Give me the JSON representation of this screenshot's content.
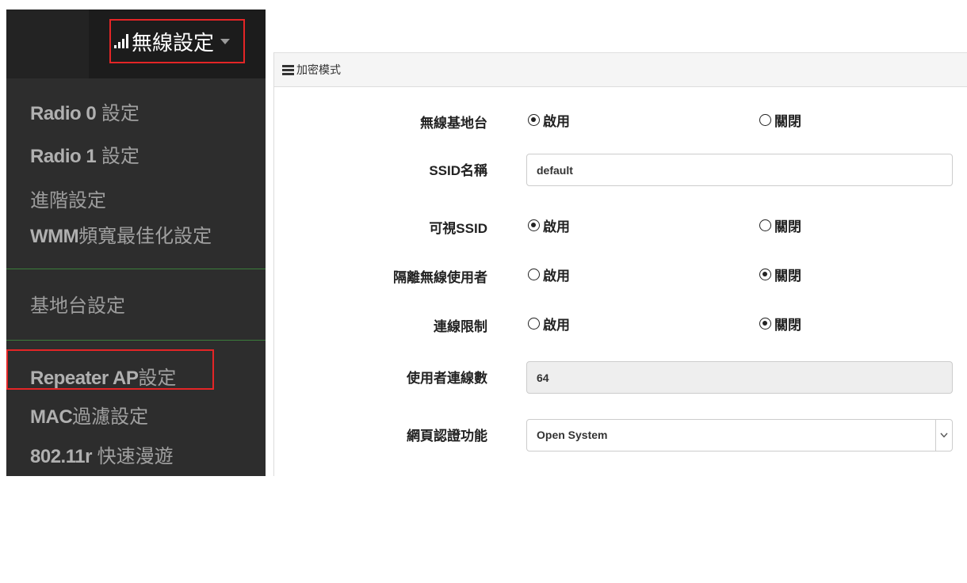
{
  "sidebar": {
    "menu_title": "無線設定",
    "items": [
      {
        "latin": "Radio 0",
        "zh": " 設定"
      },
      {
        "latin": "Radio 1",
        "zh": " 設定"
      },
      {
        "label": "進階設定"
      },
      {
        "latin": "WMM",
        "zh": "頻寬最佳化設定"
      },
      {
        "label": "基地台設定"
      },
      {
        "latin": "Repeater AP",
        "zh": "設定"
      },
      {
        "latin": "MAC",
        "zh": "過濾設定"
      },
      {
        "latin": "802.11r",
        "zh": " 快速漫遊"
      }
    ]
  },
  "panel": {
    "title": "加密模式",
    "rows": {
      "wireless_ap": {
        "label": "無線基地台",
        "options": [
          "啟用",
          "關閉"
        ],
        "selected": "啟用"
      },
      "ssid_name": {
        "label": "SSID名稱",
        "value": "default"
      },
      "visible_ssid": {
        "label": "可視SSID",
        "options": [
          "啟用",
          "關閉"
        ],
        "selected": "啟用"
      },
      "isolate_users": {
        "label": "隔離無線使用者",
        "options": [
          "啟用",
          "關閉"
        ],
        "selected": "關閉"
      },
      "connection_limit": {
        "label": "連線限制",
        "options": [
          "啟用",
          "關閉"
        ],
        "selected": "關閉"
      },
      "user_connections": {
        "label": "使用者連線數",
        "value": "64"
      },
      "web_auth": {
        "label": "網頁認證功能",
        "value": "Open System"
      }
    }
  },
  "colors": {
    "sidebar_bg": "#2d2d2d",
    "sidebar_header_bg": "#1c1c1c",
    "highlight_border": "#e32526",
    "divider": "#3b7d3b"
  },
  "icons": {
    "menu": "signal-bars-icon",
    "caret": "caret-down-icon",
    "panel_header": "list-icon",
    "select": "chevron-down-icon"
  }
}
